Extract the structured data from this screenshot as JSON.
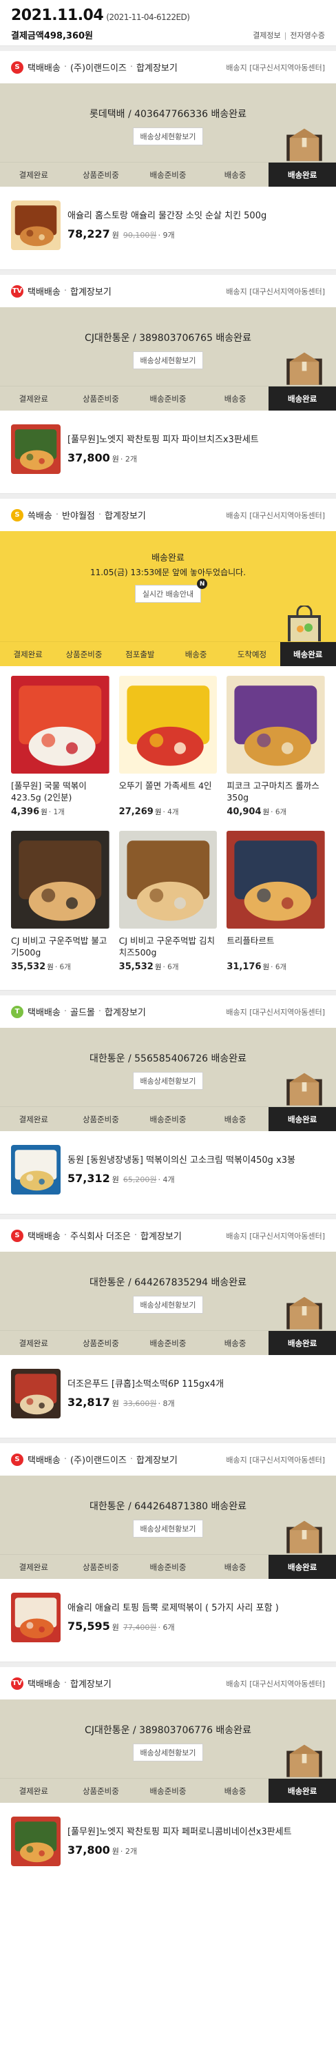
{
  "header": {
    "date": "2021.11.04",
    "order_no": "(2021-11-04-6122ED)",
    "pay_label": "결제금액",
    "pay_amount": "498,360원",
    "link_payinfo": "결제정보",
    "link_receipt": "전자영수증"
  },
  "steps_normal": [
    "결제완료",
    "상품준비중",
    "배송준비중",
    "배송중",
    "배송완료"
  ],
  "steps_fresh": [
    "결제완료",
    "상품준비중",
    "점포출발",
    "배송중",
    "도착예정",
    "배송완료"
  ],
  "shipments": [
    {
      "badge": "S",
      "badge_color": "#e8292a",
      "type": "택배배송",
      "seller": "(주)이랜드이즈",
      "merge": "합계장보기",
      "address": "배송지 [대구신서지역아동센터]",
      "tracking": "롯데택배 / 403647766336 배송완료",
      "button": "배송상세현황보기",
      "product": {
        "name": "애슐리 홈스토랑 애슐리 물간장 소잇 순살 치킨 500g",
        "price": "78,227",
        "unit": "원",
        "original": "90,100원",
        "qty": "· 9개",
        "icon": "fried-chicken-package"
      }
    },
    {
      "badge": "TV",
      "badge_color": "#e8292a",
      "type": "택배배송",
      "seller": "",
      "merge": "합계장보기",
      "address": "배송지 [대구신서지역아동센터]",
      "tracking": "CJ대한통운 / 389803706765 배송완료",
      "button": "배송상세현황보기",
      "product": {
        "name": "[풀무원]노엣지 꽉찬토핑 피자 파이브치즈x3판세트",
        "price": "37,800",
        "unit": "원",
        "original": "",
        "qty": "· 2개",
        "icon": "pizza-package"
      }
    },
    {
      "badge": "S",
      "badge_color": "#f4b400",
      "type": "쓱배송",
      "seller": "반야월점",
      "merge": "합계장보기",
      "address": "배송지 [대구신서지역아동센터]",
      "status": "배송완료",
      "detail": "11.05(금) 13:53에문 앞에 놓아두었습니다.",
      "button": "실시간 배송안내",
      "new_mark": "N",
      "items": [
        {
          "name": "[풀무원] 국물 떡볶이 423.5g (2인분)",
          "price": "4,396",
          "unit": "원",
          "qty": "· 1개",
          "icon": "tteokbokki-package"
        },
        {
          "name": "오뚜기 쫄면 가족세트 4인",
          "price": "27,269",
          "unit": "원",
          "qty": "· 4개",
          "icon": "jjolmyeon-package"
        },
        {
          "name": "피코크 고구마치즈 롤까스 350g",
          "price": "40,904",
          "unit": "원",
          "qty": "· 6개",
          "icon": "rollkatsu-package"
        },
        {
          "name": "CJ 비비고 구운주먹밥 불고기500g",
          "price": "35,532",
          "unit": "원",
          "qty": "· 6개",
          "icon": "rice-ball-bulgogi-package"
        },
        {
          "name": "CJ 비비고 구운주먹밥 김치치즈500g",
          "price": "35,532",
          "unit": "원",
          "qty": "· 6개",
          "icon": "rice-ball-kimchi-package"
        },
        {
          "name": "트리플타르트",
          "price": "31,176",
          "unit": "원",
          "qty": "· 6개",
          "icon": "tart-tray"
        }
      ]
    },
    {
      "badge": "T",
      "badge_color": "#7cc142",
      "type": "택배배송",
      "seller": "골드몰",
      "merge": "합계장보기",
      "address": "배송지 [대구신서지역아동센터]",
      "tracking": "대한통운 / 556585406726 배송완료",
      "button": "배송상세현황보기",
      "product": {
        "name": "동원 [동원냉장냉동] 떡볶이의신 고소크림 떡볶이450g x3봉",
        "price": "57,312",
        "unit": "원",
        "original": "65,200원",
        "qty": "· 4개",
        "icon": "cream-tteokbokki-package"
      }
    },
    {
      "badge": "S",
      "badge_color": "#e8292a",
      "type": "택배배송",
      "seller": "주식회사 더조은",
      "merge": "합계장보기",
      "address": "배송지 [대구신서지역아동센터]",
      "tracking": "대한통운 / 644267835294 배송완료",
      "button": "배송상세현황보기",
      "product": {
        "name": "더조은푸드 [큐홉]소떡소떡6P 115gx4개",
        "price": "32,817",
        "unit": "원",
        "original": "33,600원",
        "qty": "· 8개",
        "icon": "sotteok-package"
      }
    },
    {
      "badge": "S",
      "badge_color": "#e8292a",
      "type": "택배배송",
      "seller": "(주)이랜드이즈",
      "merge": "합계장보기",
      "address": "배송지 [대구신서지역아동센터]",
      "tracking": "대한통운 / 644264871380 배송완료",
      "button": "배송상세현황보기",
      "product": {
        "name": "애슐리 애슐리 토핑 듬뿍 로제떡볶이 ( 5가지 사리 포함 )",
        "price": "75,595",
        "unit": "원",
        "original": "77,400원",
        "qty": "· 6개",
        "icon": "rose-tteokbokki-dish"
      }
    },
    {
      "badge": "TV",
      "badge_color": "#e8292a",
      "type": "택배배송",
      "seller": "",
      "merge": "합계장보기",
      "address": "배송지 [대구신서지역아동센터]",
      "tracking": "CJ대한통운 / 389803706776 배송완료",
      "button": "배송상세현황보기",
      "product": {
        "name": "[풀무원]노엣지 꽉찬토핑 피자 페퍼로니콤비네이션x3판세트",
        "price": "37,800",
        "unit": "원",
        "original": "",
        "qty": "· 2개",
        "icon": "pizza-package"
      }
    }
  ]
}
